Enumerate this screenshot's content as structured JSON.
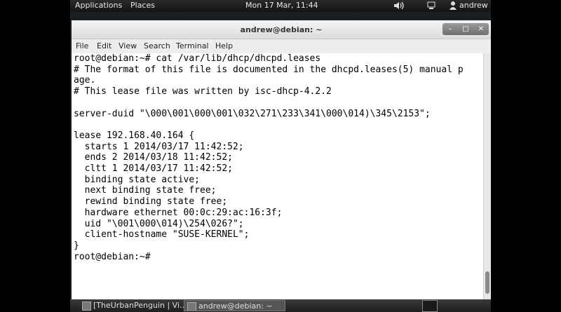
{
  "top_panel": {
    "applications_label": "Applications",
    "places_label": "Places",
    "clock": "Mon 17 Mar, 11:44",
    "volume_icon": "volume-icon",
    "network_icon": "network-icon",
    "user_label": "andrew"
  },
  "terminal_window": {
    "title": "andrew@debian: ~",
    "menu": [
      "File",
      "Edit",
      "View",
      "Search",
      "Terminal",
      "Help"
    ],
    "lines": [
      "root@debian:~# cat /var/lib/dhcp/dhcpd.leases",
      "# The format of this file is documented in the dhcpd.leases(5) manual p",
      "age.",
      "# This lease file was written by isc-dhcp-4.2.2",
      "",
      "server-duid \"\\000\\001\\000\\001\\032\\271\\233\\341\\000\\014)\\345\\2153\";",
      "",
      "lease 192.168.40.164 {",
      "  starts 1 2014/03/17 11:42:52;",
      "  ends 2 2014/03/18 11:42:52;",
      "  cltt 1 2014/03/17 11:42:52;",
      "  binding state active;",
      "  next binding state free;",
      "  rewind binding state free;",
      "  hardware ethernet 00:0c:29:ac:16:3f;",
      "  uid \"\\001\\000\\014)\\254\\026?\";",
      "  client-hostname \"SUSE-KERNEL\";",
      "}",
      "root@debian:~#"
    ]
  },
  "taskbar": {
    "items": [
      {
        "label": "[TheUrbanPenguin | Vi..."
      },
      {
        "label": "andrew@debian: ~"
      }
    ]
  }
}
